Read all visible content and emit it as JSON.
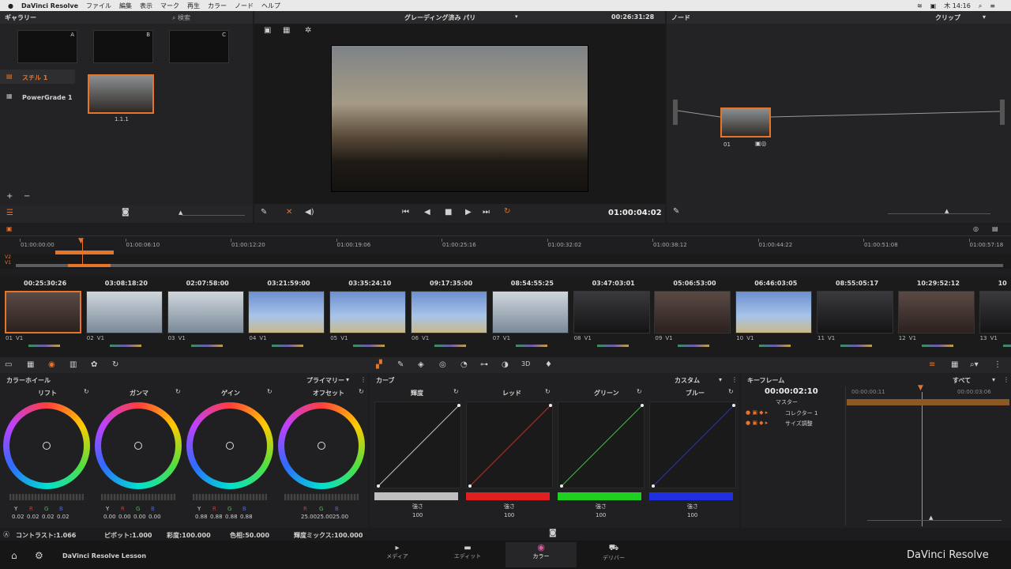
{
  "menubar": {
    "apple": "",
    "app": "DaVinci Resolve",
    "items": [
      "ファイル",
      "編集",
      "表示",
      "マーク",
      "再生",
      "カラー",
      "ノード",
      "ヘルプ"
    ],
    "clock": "木 14:16"
  },
  "gallery": {
    "title": "ギャラリー",
    "search": "検索",
    "stills_label": "スチル 1",
    "powergrade_label": "PowerGrade 1",
    "still_id": "1.1.1",
    "slot_labels": [
      "A",
      "B",
      "C"
    ]
  },
  "viewer": {
    "title": "グレーディング済み パリ",
    "timecode": "00:26:31:28",
    "playhead_tc": "01:00:04:02"
  },
  "nodes": {
    "title": "ノード",
    "clip_label": "クリップ",
    "node_label": "01"
  },
  "timeline": {
    "ruler": [
      "01:00:00:00",
      "01:00:06:10",
      "01:00:12:20",
      "01:00:19:06",
      "01:00:25:16",
      "01:00:32:02",
      "01:00:38:12",
      "01:00:44:22",
      "01:00:51:08",
      "01:00:57:18"
    ],
    "track_labels": [
      "V2",
      "V1"
    ]
  },
  "clips": [
    {
      "tc": "00:25:30:26",
      "id": "01",
      "track": "V1",
      "style": "warm"
    },
    {
      "tc": "03:08:18:20",
      "id": "02",
      "track": "V1",
      "style": "bld"
    },
    {
      "tc": "02:07:58:00",
      "id": "03",
      "track": "V1",
      "style": "bld"
    },
    {
      "tc": "03:21:59:00",
      "id": "04",
      "track": "V1",
      "style": "sky"
    },
    {
      "tc": "03:35:24:10",
      "id": "05",
      "track": "V1",
      "style": "sky"
    },
    {
      "tc": "09:17:35:00",
      "id": "06",
      "track": "V1",
      "style": "sky"
    },
    {
      "tc": "08:54:55:25",
      "id": "07",
      "track": "V1",
      "style": "bld"
    },
    {
      "tc": "03:47:03:01",
      "id": "08",
      "track": "V1",
      "style": "dark"
    },
    {
      "tc": "05:06:53:00",
      "id": "09",
      "track": "V1",
      "style": "warm"
    },
    {
      "tc": "06:46:03:05",
      "id": "10",
      "track": "V1",
      "style": "sky"
    },
    {
      "tc": "08:55:05:17",
      "id": "11",
      "track": "V1",
      "style": "dark"
    },
    {
      "tc": "10:29:52:12",
      "id": "12",
      "track": "V1",
      "style": "warm"
    },
    {
      "tc": "10",
      "id": "13",
      "track": "V1",
      "style": "dark"
    }
  ],
  "colorwheels": {
    "title": "カラーホイール",
    "mode": "プライマリー",
    "wheels": [
      {
        "name": "リフト",
        "labels": [
          "Y",
          "R",
          "G",
          "B"
        ],
        "values": [
          "0.02",
          "0.02",
          "0.02",
          "0.02"
        ]
      },
      {
        "name": "ガンマ",
        "labels": [
          "Y",
          "R",
          "G",
          "B"
        ],
        "values": [
          "0.00",
          "0.00",
          "0.00",
          "0.00"
        ]
      },
      {
        "name": "ゲイン",
        "labels": [
          "Y",
          "R",
          "G",
          "B"
        ],
        "values": [
          "0.88",
          "0.88",
          "0.88",
          "0.88"
        ]
      },
      {
        "name": "オフセット",
        "labels": [
          "R",
          "G",
          "B"
        ],
        "values": [
          "25.00",
          "25.00",
          "25.00"
        ]
      }
    ],
    "bottombar": {
      "contrast": "コントラスト:1.066",
      "pivot": "ピボット:1.000",
      "sat": "彩度:100.000",
      "hue": "色相:50.000",
      "lummix": "輝度ミックス:100.000"
    }
  },
  "curves": {
    "title": "カーブ",
    "mode": "カスタム",
    "channels": [
      {
        "name": "輝度",
        "color": "#bfbfbf",
        "strength_label": "強さ",
        "strength": "100"
      },
      {
        "name": "レッド",
        "color": "#e02020",
        "strength_label": "強さ",
        "strength": "100"
      },
      {
        "name": "グリーン",
        "color": "#20d020",
        "strength_label": "強さ",
        "strength": "100"
      },
      {
        "name": "ブルー",
        "color": "#2030e0",
        "strength_label": "強さ",
        "strength": "100"
      }
    ]
  },
  "keyframes": {
    "title": "キーフレーム",
    "filter": "すべて",
    "tc": "00:00:02:10",
    "tc_a": "00:00:00:11",
    "tc_b": "00:00:03:06",
    "master": "マスター",
    "rows": [
      "コレクター 1",
      "サイズ調整"
    ]
  },
  "pages": {
    "project": "DaVinci Resolve Lesson",
    "tabs": [
      "メディア",
      "エディット",
      "カラー",
      "デリバー"
    ],
    "brand": "DaVinci Resolve"
  }
}
